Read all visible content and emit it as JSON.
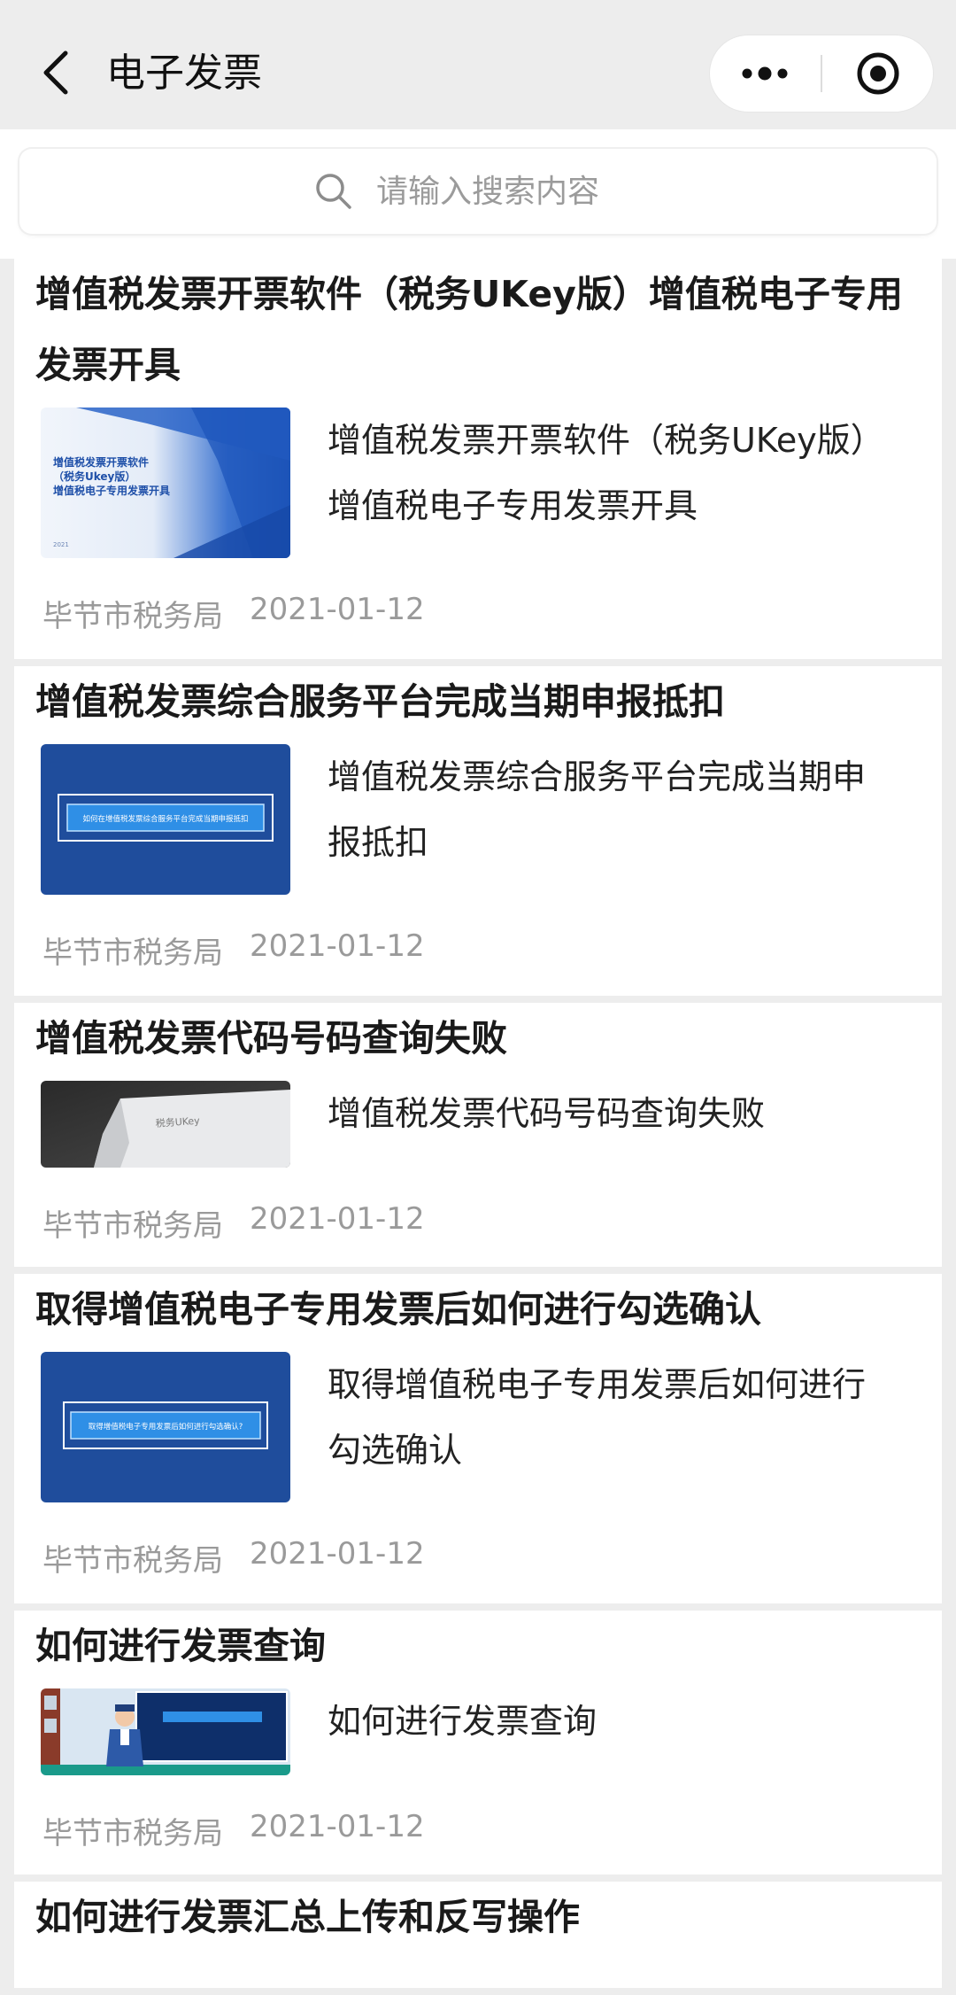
{
  "header": {
    "title": "电子发票",
    "back_icon": "chevron-left-icon",
    "more_icon": "more-dots-icon",
    "close_icon": "target-close-icon"
  },
  "search": {
    "placeholder": "请输入搜索内容",
    "icon": "search-icon"
  },
  "articles": [
    {
      "title": "增值税发票开票软件（税务UKey版）增值税电子专用发票开具",
      "summary": "增值税发票开票软件（税务UKey版）增值税电子专用发票开具",
      "source": "毕节市税务局",
      "date": "2021-01-12",
      "thumb": {
        "lines": [
          "增值税发票开票软件",
          "（税务Ukey版）",
          "增值税电子专用发票开具"
        ],
        "footer": "2021"
      }
    },
    {
      "title": "增值税发票综合服务平台完成当期申报抵扣",
      "summary": "增值税发票综合服务平台完成当期申报抵扣",
      "source": "毕节市税务局",
      "date": "2021-01-12",
      "thumb": {
        "banner": "如何在增值税发票综合服务平台完成当期申报抵扣"
      }
    },
    {
      "title": "增值税发票代码号码查询失败",
      "summary": "增值税发票代码号码查询失败",
      "source": "毕节市税务局",
      "date": "2021-01-12",
      "thumb": {
        "device_label": "税务UKey"
      }
    },
    {
      "title": "取得增值税电子专用发票后如何进行勾选确认",
      "summary": "取得增值税电子专用发票后如何进行勾选确认",
      "source": "毕节市税务局",
      "date": "2021-01-12",
      "thumb": {
        "banner": "取得增值税电子专用发票后如何进行勾选确认?"
      }
    },
    {
      "title": "如何进行发票查询",
      "summary": "如何进行发票查询",
      "source": "毕节市税务局",
      "date": "2021-01-12",
      "thumb": {}
    },
    {
      "title": "如何进行发票汇总上传和反写操作"
    }
  ],
  "colors": {
    "background": "#ededed",
    "card": "#ffffff",
    "meta_text": "#9a9a9a",
    "thumb_blue": "#1f4d9c"
  }
}
